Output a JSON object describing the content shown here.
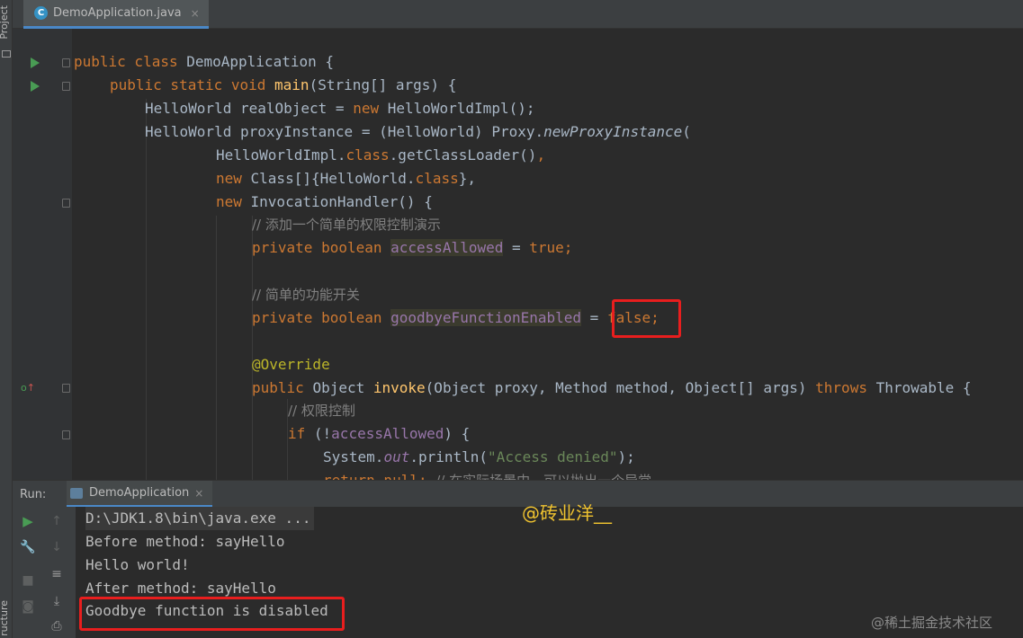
{
  "sidebar": {
    "project_label": "Project",
    "structure_label": "ructure"
  },
  "editor_tab": {
    "filename": "DemoApplication.java",
    "icon_letter": "C",
    "close": "×"
  },
  "code": {
    "l1": {
      "a": "public class ",
      "b": "DemoApplication {"
    },
    "l2": {
      "a": "public static void ",
      "b": "main",
      "c": "(String[] args) {"
    },
    "l3": {
      "a": "HelloWorld realObject = ",
      "b": "new ",
      "c": "HelloWorldImpl();"
    },
    "l4": {
      "a": "HelloWorld proxyInstance = (HelloWorld) Proxy.",
      "b": "newProxyInstance",
      "c": "("
    },
    "l5": {
      "a": "HelloWorldImpl.",
      "b": "class",
      "c": ".getClassLoader()",
      "d": ","
    },
    "l6": {
      "a": "new ",
      "b": "Class[]{HelloWorld.",
      "c": "class",
      "d": "},"
    },
    "l7": {
      "a": "new ",
      "b": "InvocationHandler() {"
    },
    "l8": {
      "comment": "// 添加一个简单的权限控制演示"
    },
    "l9": {
      "a": "private boolean ",
      "b": "accessAllowed",
      "c": " = ",
      "d": "true;"
    },
    "l10": {
      "comment": "// 简单的功能开关"
    },
    "l11": {
      "a": "private boolean ",
      "b": "goodbyeFunctionEnabled",
      "c": " = ",
      "d": "false;"
    },
    "l12": {
      "a": "@Override"
    },
    "l13": {
      "a": "public ",
      "b": "Object ",
      "c": "invoke",
      "d": "(Object proxy, Method method, Object[] args) ",
      "e": "throws ",
      "f": "Throwable {"
    },
    "l14": {
      "comment": "// 权限控制"
    },
    "l15": {
      "a": "if ",
      "b": "(!",
      "c": "accessAllowed",
      "d": ") {"
    },
    "l16": {
      "a": "System.",
      "b": "out",
      "c": ".println(",
      "d": "\"Access denied\"",
      "e": ");"
    },
    "l17": {
      "a": "return null",
      "b": "; ",
      "comment": "// 在实际场景中，可以抛出一个异常"
    }
  },
  "run_panel": {
    "label": "Run:",
    "tab_name": "DemoApplication",
    "close": "×",
    "console_lines": [
      "D:\\JDK1.8\\bin\\java.exe ...",
      "Before method: sayHello",
      "Hello world!",
      "After method: sayHello",
      "Goodbye function is disabled"
    ]
  },
  "watermarks": {
    "author": "@砖业洋__",
    "site": "@稀土掘金技术社区"
  },
  "colors": {
    "highlight_border": "#e81e1e",
    "keyword": "#cc7832",
    "method": "#ffc66d",
    "field": "#9876aa",
    "comment": "#808080",
    "string": "#6a8759",
    "annotation": "#bbb529"
  }
}
